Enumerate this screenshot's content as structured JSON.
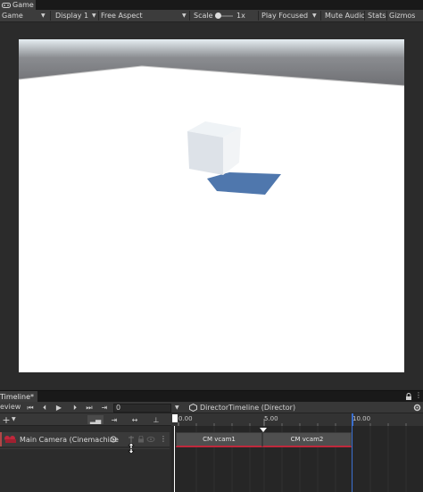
{
  "game_window": {
    "tab_label": "Game",
    "toolbar": {
      "view_mode": "Game",
      "display": "Display 1",
      "aspect": "Free Aspect",
      "scale_label": "Scale",
      "scale_value": "1x",
      "play_focused": "Play Focused",
      "mute_audio": "Mute Audio",
      "stats": "Stats",
      "gizmos": "Gizmos"
    }
  },
  "timeline_window": {
    "tab_label": "Timeline*",
    "preview_label": "eview",
    "current_frame": "0",
    "director_label": "DirectorTimeline (Director)",
    "ruler_ticks": [
      "0.00",
      "5.00",
      "10.00"
    ],
    "track": {
      "name": "Main Camera (Cinemachine"
    },
    "clips": [
      {
        "label": "CM vcam1"
      },
      {
        "label": "CM vcam2"
      }
    ]
  },
  "colors": {
    "sky_top": "#7e7f83",
    "floor": "#ffffff",
    "track_accent": "#c0283c",
    "playhead": "#ffffff",
    "end_marker": "#3a6fd0"
  },
  "icons": [
    "unity-game-icon",
    "lock-icon",
    "settings-icon",
    "play-icon",
    "step-icon",
    "add-icon",
    "camera-track-icon",
    "target-icon",
    "mute-icon",
    "menu-icon"
  ]
}
